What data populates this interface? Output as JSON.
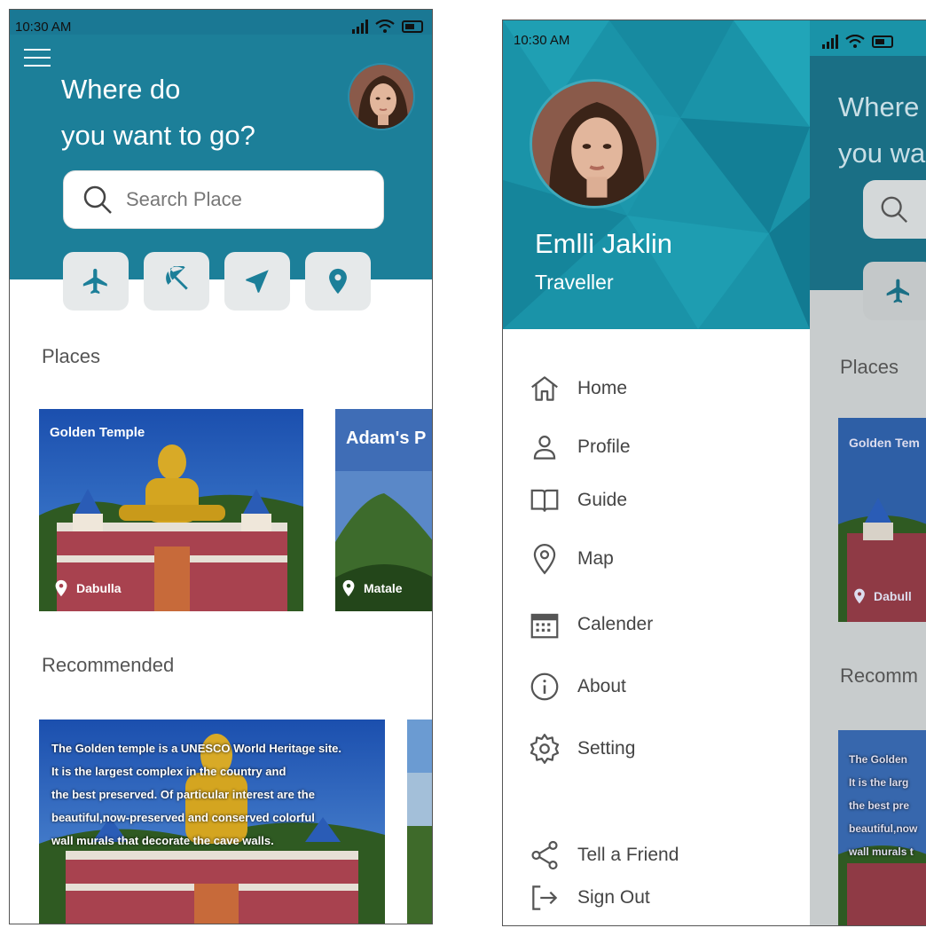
{
  "status": {
    "time": "10:30 AM"
  },
  "home": {
    "headline_line1": "Where do",
    "headline_line2": "you want to go?",
    "search_placeholder": "Search Place",
    "categories": [
      "airplane-icon",
      "umbrella-icon",
      "navigation-icon",
      "location-pin-icon"
    ],
    "places_title": "Places",
    "places": [
      {
        "name": "Golden Temple",
        "location": "Dabulla"
      },
      {
        "name": "Adam's P",
        "location": "Matale"
      }
    ],
    "recommended_title": "Recommended",
    "recommended": [
      {
        "text": "The Golden temple is a UNESCO World Heritage site.\n It is the largest complex in the country and\nthe best preserved. Of particular interest are the\nbeautiful,now-preserved and conserved colorful\nwall murals that decorate the cave walls."
      }
    ]
  },
  "drawer": {
    "user_name": "Emlli Jaklin",
    "user_role": "Traveller",
    "menu": [
      {
        "label": "Home",
        "icon": "home-icon"
      },
      {
        "label": "Profile",
        "icon": "user-icon"
      },
      {
        "label": "Guide",
        "icon": "book-icon"
      },
      {
        "label": "Map",
        "icon": "map-pin-icon"
      },
      {
        "label": "Calender",
        "icon": "calendar-icon"
      },
      {
        "label": "About",
        "icon": "info-icon"
      },
      {
        "label": "Setting",
        "icon": "gear-icon"
      }
    ],
    "footer_menu": [
      {
        "label": "Tell a Friend",
        "icon": "share-icon"
      },
      {
        "label": "Sign Out",
        "icon": "sign-out-icon"
      }
    ]
  },
  "background_peek": {
    "headline_line1": "Where",
    "headline_line2": "you wa",
    "places_title": "Places",
    "place_name": "Golden Tem",
    "place_location": "Dabull",
    "recommended_title": "Recomm",
    "recommended_text": "The Golden\n It is the larg\nthe best pre\nbeautiful,now\nwall murals t"
  },
  "colors": {
    "header_teal": "#1c7f99",
    "drawer_teal": "#1a93a8",
    "white": "#ffffff"
  }
}
